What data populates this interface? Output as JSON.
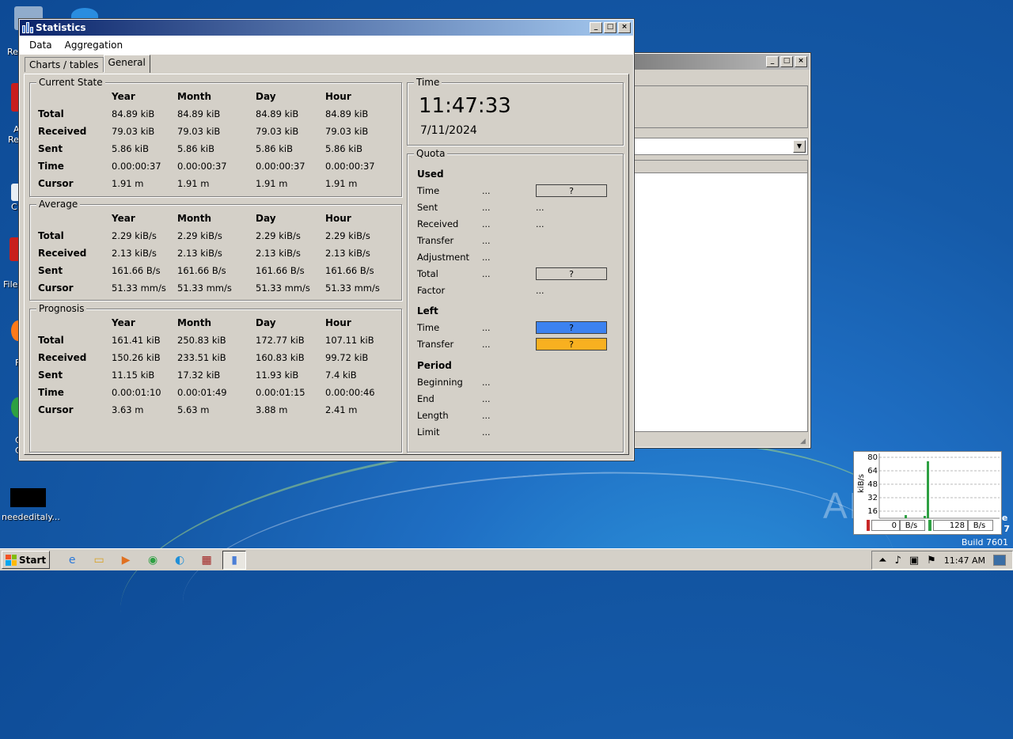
{
  "desktop": {
    "left_labels": [
      "Re",
      "A",
      "Re",
      "C",
      "File",
      "F",
      "C",
      "C"
    ],
    "file_label": "neededitaly...",
    "watermark": "ANY.RUN",
    "build": "Build 7601",
    "edge_de": "de",
    "edge_7": "s 7"
  },
  "bgwindow": {
    "controls": {
      "minimize": "_",
      "maximize": "□",
      "close": "×"
    }
  },
  "stats": {
    "title": "Statistics",
    "controls": {
      "minimize": "_",
      "maximize": "□",
      "close": "×"
    },
    "menu": [
      "Data",
      "Aggregation"
    ],
    "tabs": [
      "Charts / tables",
      "General"
    ],
    "columns": [
      "Year",
      "Month",
      "Day",
      "Hour"
    ],
    "current": {
      "title": "Current State",
      "rows": [
        {
          "label": "Total",
          "values": [
            "84.89 kiB",
            "84.89 kiB",
            "84.89 kiB",
            "84.89 kiB"
          ]
        },
        {
          "label": "Received",
          "values": [
            "79.03 kiB",
            "79.03 kiB",
            "79.03 kiB",
            "79.03 kiB"
          ]
        },
        {
          "label": "Sent",
          "values": [
            "5.86 kiB",
            "5.86 kiB",
            "5.86 kiB",
            "5.86 kiB"
          ]
        },
        {
          "label": "Time",
          "values": [
            "0.00:00:37",
            "0.00:00:37",
            "0.00:00:37",
            "0.00:00:37"
          ]
        },
        {
          "label": "Cursor",
          "values": [
            "1.91 m",
            "1.91 m",
            "1.91 m",
            "1.91 m"
          ]
        }
      ]
    },
    "average": {
      "title": "Average",
      "rows": [
        {
          "label": "Total",
          "values": [
            "2.29 kiB/s",
            "2.29 kiB/s",
            "2.29 kiB/s",
            "2.29 kiB/s"
          ]
        },
        {
          "label": "Received",
          "values": [
            "2.13 kiB/s",
            "2.13 kiB/s",
            "2.13 kiB/s",
            "2.13 kiB/s"
          ]
        },
        {
          "label": "Sent",
          "values": [
            "161.66 B/s",
            "161.66 B/s",
            "161.66 B/s",
            "161.66 B/s"
          ]
        },
        {
          "label": "Cursor",
          "values": [
            "51.33 mm/s",
            "51.33 mm/s",
            "51.33 mm/s",
            "51.33 mm/s"
          ]
        }
      ]
    },
    "prognosis": {
      "title": "Prognosis",
      "rows": [
        {
          "label": "Total",
          "values": [
            "161.41 kiB",
            "250.83 kiB",
            "172.77 kiB",
            "107.11 kiB"
          ]
        },
        {
          "label": "Received",
          "values": [
            "150.26 kiB",
            "233.51 kiB",
            "160.83 kiB",
            "99.72 kiB"
          ]
        },
        {
          "label": "Sent",
          "values": [
            "11.15 kiB",
            "17.32 kiB",
            "11.93 kiB",
            "7.4 kiB"
          ]
        },
        {
          "label": "Time",
          "values": [
            "0.00:01:10",
            "0.00:01:49",
            "0.00:01:15",
            "0.00:00:46"
          ]
        },
        {
          "label": "Cursor",
          "values": [
            "3.63 m",
            "5.63 m",
            "3.88 m",
            "2.41 m"
          ]
        }
      ]
    },
    "time": {
      "title": "Time",
      "clock": "11:47:33",
      "date": "7/11/2024"
    },
    "quota": {
      "title": "Quota",
      "used_title": "Used",
      "left_title": "Left",
      "period_title": "Period",
      "dots": "...",
      "q": "?",
      "used": [
        "Time",
        "Sent",
        "Received",
        "Transfer",
        "Adjustment",
        "Total",
        "Factor"
      ],
      "left": [
        "Time",
        "Transfer"
      ],
      "period": [
        "Beginning",
        "End",
        "Length",
        "Limit"
      ],
      "colors": {
        "left_time": "#3c82f0",
        "left_transfer": "#f8b020"
      }
    }
  },
  "meter": {
    "ylabel": "kiB/s",
    "ticks": [
      "80",
      "64",
      "48",
      "32",
      "16"
    ],
    "field1": "0",
    "unit1": "B/s",
    "field2": "128",
    "unit2": "B/s"
  },
  "taskbar": {
    "start": "Start",
    "time": "11:47 AM"
  }
}
